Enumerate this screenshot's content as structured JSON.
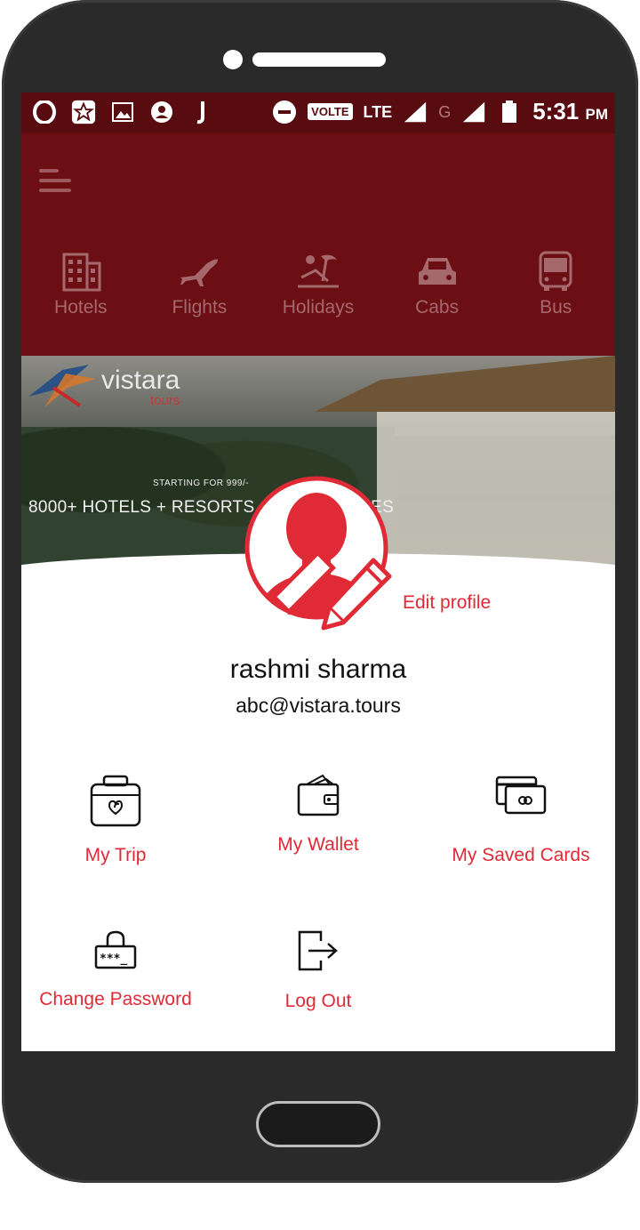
{
  "status_bar": {
    "time": "5:31",
    "ampm": "PM",
    "volte": "VOLTE",
    "lte": "LTE",
    "g": "G"
  },
  "categories": [
    {
      "label": "Hotels",
      "icon": "building-icon"
    },
    {
      "label": "Flights",
      "icon": "airplane-icon"
    },
    {
      "label": "Holidays",
      "icon": "beach-icon"
    },
    {
      "label": "Cabs",
      "icon": "car-icon"
    },
    {
      "label": "Bus",
      "icon": "bus-icon"
    }
  ],
  "banner": {
    "logo_name": "vistara",
    "logo_sub": "tours",
    "starting_for": "STARTING FOR   999/-",
    "headline": "8000+ HOTELS + RESORTS AND COTTAGES"
  },
  "profile": {
    "edit_label": "Edit profile",
    "name": "rashmi sharma",
    "email": "abc@vistara.tours"
  },
  "menu": {
    "my_trip": "My Trip",
    "my_wallet": "My Wallet",
    "my_saved_cards": "My Saved Cards",
    "change_password": "Change Password",
    "log_out": "Log Out"
  },
  "colors": {
    "status_bar": "#590c10",
    "app_bar": "#6b0f14",
    "accent": "#e02a36"
  }
}
